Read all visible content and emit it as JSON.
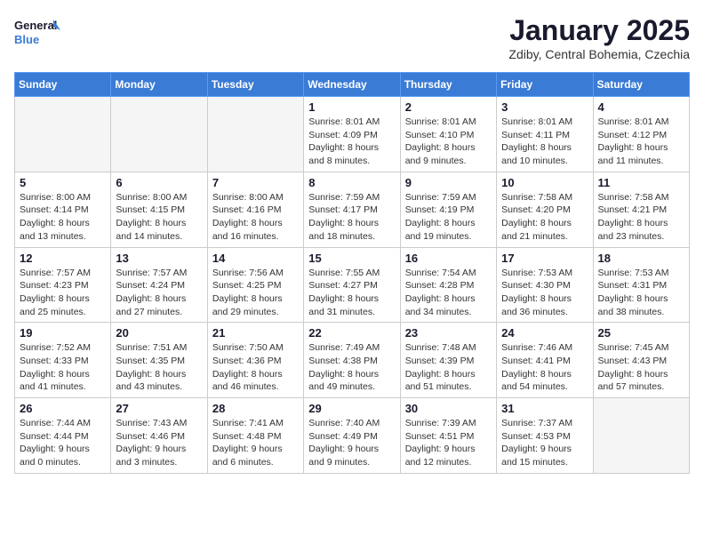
{
  "header": {
    "logo_line1": "General",
    "logo_line2": "Blue",
    "month": "January 2025",
    "location": "Zdiby, Central Bohemia, Czechia"
  },
  "weekdays": [
    "Sunday",
    "Monday",
    "Tuesday",
    "Wednesday",
    "Thursday",
    "Friday",
    "Saturday"
  ],
  "weeks": [
    [
      {
        "day": "",
        "info": ""
      },
      {
        "day": "",
        "info": ""
      },
      {
        "day": "",
        "info": ""
      },
      {
        "day": "1",
        "info": "Sunrise: 8:01 AM\nSunset: 4:09 PM\nDaylight: 8 hours\nand 8 minutes."
      },
      {
        "day": "2",
        "info": "Sunrise: 8:01 AM\nSunset: 4:10 PM\nDaylight: 8 hours\nand 9 minutes."
      },
      {
        "day": "3",
        "info": "Sunrise: 8:01 AM\nSunset: 4:11 PM\nDaylight: 8 hours\nand 10 minutes."
      },
      {
        "day": "4",
        "info": "Sunrise: 8:01 AM\nSunset: 4:12 PM\nDaylight: 8 hours\nand 11 minutes."
      }
    ],
    [
      {
        "day": "5",
        "info": "Sunrise: 8:00 AM\nSunset: 4:14 PM\nDaylight: 8 hours\nand 13 minutes."
      },
      {
        "day": "6",
        "info": "Sunrise: 8:00 AM\nSunset: 4:15 PM\nDaylight: 8 hours\nand 14 minutes."
      },
      {
        "day": "7",
        "info": "Sunrise: 8:00 AM\nSunset: 4:16 PM\nDaylight: 8 hours\nand 16 minutes."
      },
      {
        "day": "8",
        "info": "Sunrise: 7:59 AM\nSunset: 4:17 PM\nDaylight: 8 hours\nand 18 minutes."
      },
      {
        "day": "9",
        "info": "Sunrise: 7:59 AM\nSunset: 4:19 PM\nDaylight: 8 hours\nand 19 minutes."
      },
      {
        "day": "10",
        "info": "Sunrise: 7:58 AM\nSunset: 4:20 PM\nDaylight: 8 hours\nand 21 minutes."
      },
      {
        "day": "11",
        "info": "Sunrise: 7:58 AM\nSunset: 4:21 PM\nDaylight: 8 hours\nand 23 minutes."
      }
    ],
    [
      {
        "day": "12",
        "info": "Sunrise: 7:57 AM\nSunset: 4:23 PM\nDaylight: 8 hours\nand 25 minutes."
      },
      {
        "day": "13",
        "info": "Sunrise: 7:57 AM\nSunset: 4:24 PM\nDaylight: 8 hours\nand 27 minutes."
      },
      {
        "day": "14",
        "info": "Sunrise: 7:56 AM\nSunset: 4:25 PM\nDaylight: 8 hours\nand 29 minutes."
      },
      {
        "day": "15",
        "info": "Sunrise: 7:55 AM\nSunset: 4:27 PM\nDaylight: 8 hours\nand 31 minutes."
      },
      {
        "day": "16",
        "info": "Sunrise: 7:54 AM\nSunset: 4:28 PM\nDaylight: 8 hours\nand 34 minutes."
      },
      {
        "day": "17",
        "info": "Sunrise: 7:53 AM\nSunset: 4:30 PM\nDaylight: 8 hours\nand 36 minutes."
      },
      {
        "day": "18",
        "info": "Sunrise: 7:53 AM\nSunset: 4:31 PM\nDaylight: 8 hours\nand 38 minutes."
      }
    ],
    [
      {
        "day": "19",
        "info": "Sunrise: 7:52 AM\nSunset: 4:33 PM\nDaylight: 8 hours\nand 41 minutes."
      },
      {
        "day": "20",
        "info": "Sunrise: 7:51 AM\nSunset: 4:35 PM\nDaylight: 8 hours\nand 43 minutes."
      },
      {
        "day": "21",
        "info": "Sunrise: 7:50 AM\nSunset: 4:36 PM\nDaylight: 8 hours\nand 46 minutes."
      },
      {
        "day": "22",
        "info": "Sunrise: 7:49 AM\nSunset: 4:38 PM\nDaylight: 8 hours\nand 49 minutes."
      },
      {
        "day": "23",
        "info": "Sunrise: 7:48 AM\nSunset: 4:39 PM\nDaylight: 8 hours\nand 51 minutes."
      },
      {
        "day": "24",
        "info": "Sunrise: 7:46 AM\nSunset: 4:41 PM\nDaylight: 8 hours\nand 54 minutes."
      },
      {
        "day": "25",
        "info": "Sunrise: 7:45 AM\nSunset: 4:43 PM\nDaylight: 8 hours\nand 57 minutes."
      }
    ],
    [
      {
        "day": "26",
        "info": "Sunrise: 7:44 AM\nSunset: 4:44 PM\nDaylight: 9 hours\nand 0 minutes."
      },
      {
        "day": "27",
        "info": "Sunrise: 7:43 AM\nSunset: 4:46 PM\nDaylight: 9 hours\nand 3 minutes."
      },
      {
        "day": "28",
        "info": "Sunrise: 7:41 AM\nSunset: 4:48 PM\nDaylight: 9 hours\nand 6 minutes."
      },
      {
        "day": "29",
        "info": "Sunrise: 7:40 AM\nSunset: 4:49 PM\nDaylight: 9 hours\nand 9 minutes."
      },
      {
        "day": "30",
        "info": "Sunrise: 7:39 AM\nSunset: 4:51 PM\nDaylight: 9 hours\nand 12 minutes."
      },
      {
        "day": "31",
        "info": "Sunrise: 7:37 AM\nSunset: 4:53 PM\nDaylight: 9 hours\nand 15 minutes."
      },
      {
        "day": "",
        "info": ""
      }
    ]
  ]
}
